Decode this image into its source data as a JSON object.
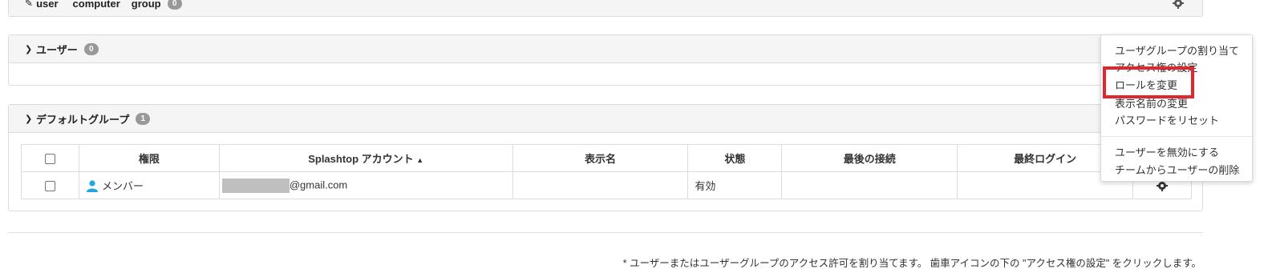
{
  "top_panel": {
    "labels": [
      "user",
      "computer",
      "group"
    ],
    "badge": "0"
  },
  "users_panel": {
    "title": "ユーザー",
    "badge": "0"
  },
  "default_group_panel": {
    "title": "デフォルトグループ",
    "badge": "1",
    "columns": [
      "権限",
      "Splashtop アカウント",
      "表示名",
      "状態",
      "最後の接続",
      "最終ログイン"
    ],
    "sort_indicator": "▲",
    "rows": [
      {
        "role": "メンバー",
        "account": "@gmail.com",
        "display_name": "",
        "status": "有効",
        "last_connection": "",
        "last_login": ""
      }
    ]
  },
  "context_menu": {
    "items": [
      "ユーザグループの割り当て",
      "アクセス権の設定",
      "ロールを変更",
      "表示名前の変更",
      "パスワードをリセット",
      "ユーザーを無効にする",
      "チームからユーザーの削除"
    ],
    "highlighted": "ロールを変更",
    "highlight_color": "#e2262f"
  },
  "footer_note": "* ユーザーまたはユーザーグループのアクセス許可を割り当てます。 歯車アイコンの下の \"アクセス権の設定\" をクリックします。",
  "colors": {
    "badge": "#999999",
    "user_icon": "#1ea7e1",
    "header_bg": "#f5f5f5"
  }
}
